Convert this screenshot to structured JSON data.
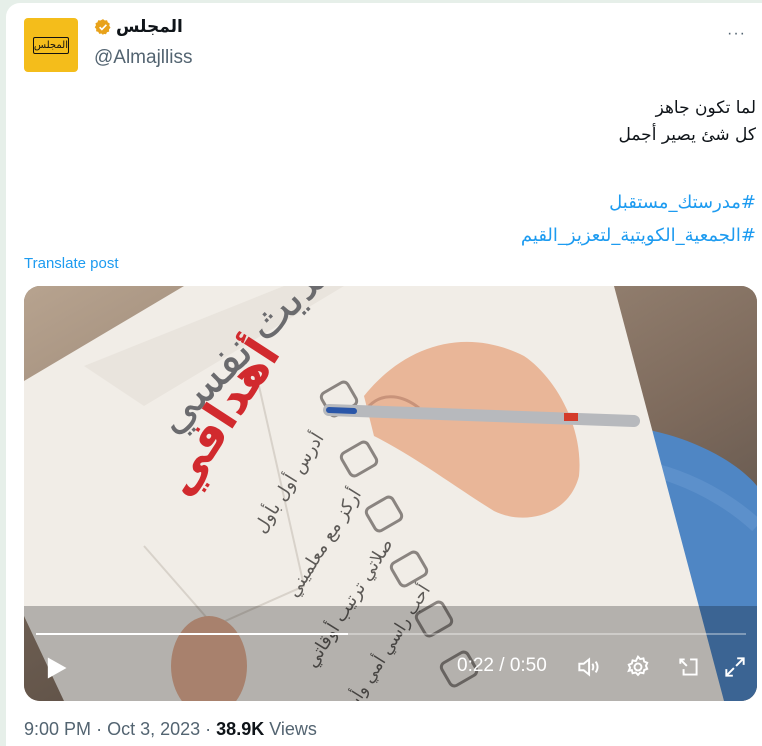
{
  "author": {
    "display_name": "المجلس",
    "handle": "@Almajlliss",
    "avatar_text": "المجلس"
  },
  "post": {
    "lines": [
      "لما تكون جاهز",
      "كل شئ يصير أجمل"
    ],
    "hashtags": [
      "#مدرستك_مستقبل",
      "#الجمعية_الكويتية_لتعزيز_القيم"
    ],
    "translate_label": "Translate post",
    "more_label": "···"
  },
  "video": {
    "time_display": "0:22 / 0:50",
    "progress_fraction": 0.44,
    "overlay_text": {
      "heading": "تحديث نفسي",
      "title": "أهدافي",
      "items": [
        "أدرس أول بأول",
        "أركز مع معلميني",
        "صلاتي ترتيب أوقاتي",
        "أحب راسي أمي وأبوي"
      ]
    }
  },
  "meta": {
    "time": "9:00 PM",
    "date": "Oct 3, 2023",
    "views_count": "38.9K",
    "views_label": "Views",
    "sep": "·"
  },
  "colors": {
    "accent": "#1d9bf0",
    "avatar_bg": "#f4bd1b",
    "verified": "#e8a21a"
  }
}
